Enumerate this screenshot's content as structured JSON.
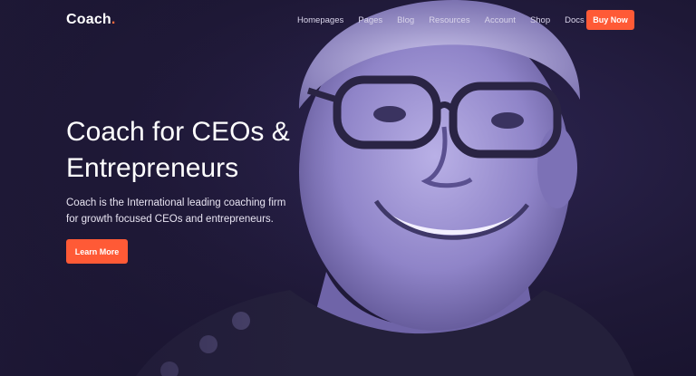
{
  "brand": {
    "name": "Coach",
    "dot": "."
  },
  "nav": {
    "items": [
      "Homepages",
      "Pages",
      "Blog",
      "Resources",
      "Account",
      "Shop",
      "Docs"
    ],
    "cta_label": "Buy Now"
  },
  "hero": {
    "headline_line1": "Coach for CEOs &",
    "headline_line2": "Entrepreneurs",
    "subtext_line1": "Coach is the International leading coaching firm",
    "subtext_line2": "for growth focused CEOs and entrepreneurs.",
    "cta_label": "Learn More"
  },
  "colors": {
    "background": "#1e1836",
    "accent": "#ff5a36",
    "text": "#ffffff"
  }
}
